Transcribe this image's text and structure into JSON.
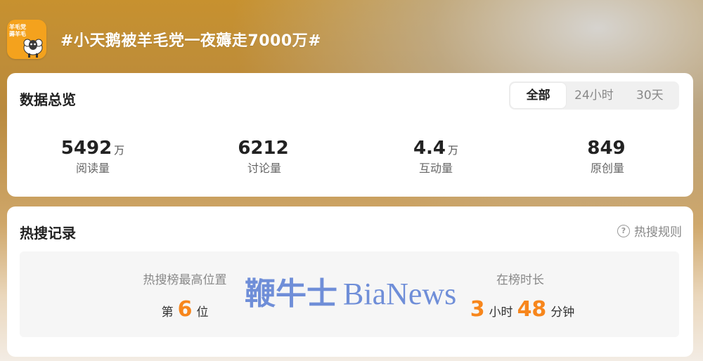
{
  "header": {
    "logo_text": "羊毛党薅羊毛",
    "topic_title": "#小天鹅被羊毛党一夜薅走7000万#"
  },
  "overview": {
    "title": "数据总览",
    "tabs": [
      "全部",
      "24小时",
      "30天"
    ],
    "stats": [
      {
        "value": "5492",
        "unit": "万",
        "label": "阅读量"
      },
      {
        "value": "6212",
        "unit": "",
        "label": "讨论量"
      },
      {
        "value": "4.4",
        "unit": "万",
        "label": "互动量"
      },
      {
        "value": "849",
        "unit": "",
        "label": "原创量"
      }
    ]
  },
  "hot": {
    "title": "热搜记录",
    "rules_label": "热搜规则",
    "rules_icon": "?",
    "peak": {
      "label": "热搜榜最高位置",
      "prefix": "第",
      "number": "6",
      "suffix": "位"
    },
    "duration": {
      "label": "在榜时长",
      "hours": "3",
      "hours_unit": "小时",
      "minutes": "48",
      "minutes_unit": "分钟"
    }
  },
  "watermark": {
    "cn": "鞭牛士",
    "en": "BiaNews"
  },
  "colors": {
    "accent_number": "#f7861c",
    "logo_bg": "#f4a21d",
    "watermark": "#6f8ed8"
  }
}
